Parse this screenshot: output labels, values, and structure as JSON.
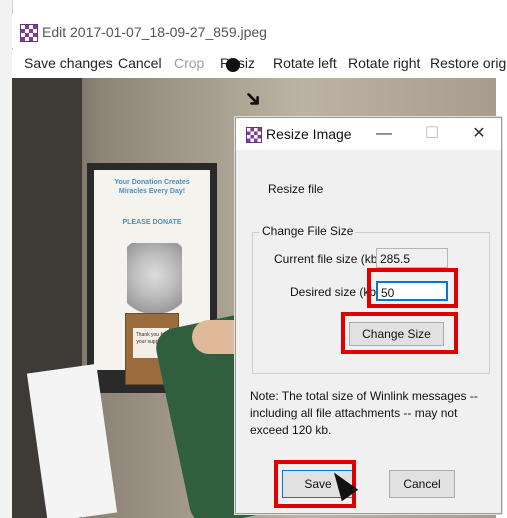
{
  "window": {
    "title": "Edit 2017-01-07_18-09-27_859.jpeg",
    "icon": "app-checker-icon"
  },
  "menu": {
    "items": [
      {
        "label": "Save changes",
        "enabled": true
      },
      {
        "label": "Cancel",
        "enabled": true
      },
      {
        "label": "Crop",
        "enabled": false
      },
      {
        "label": "Resize",
        "enabled": true
      },
      {
        "label": "Rotate left",
        "enabled": true
      },
      {
        "label": "Rotate right",
        "enabled": true
      },
      {
        "label": "Restore original",
        "enabled": true
      }
    ]
  },
  "photo": {
    "poster_title": "Your Donation Creates Miracles Every Day!",
    "poster_cta": "PLEASE DONATE",
    "box_sign": "Thank you for your support!"
  },
  "dialog": {
    "title": "Resize Image",
    "controls": {
      "minimize": "—",
      "maximize": "☐",
      "close": "✕"
    },
    "resize_label": "Resize file",
    "group_label": "Change File Size",
    "current_size_label": "Current file size (kb):",
    "current_size_value": "285.5",
    "desired_size_label": "Desired size (kb):",
    "desired_size_value": "50",
    "change_size_button": "Change Size",
    "note": "Note: The total size of Winlink messages -- including all file attachments -- may not exceed 120 kb.",
    "save_button": "Save",
    "cancel_button": "Cancel"
  },
  "colors": {
    "highlight": "#e00000",
    "focus": "#0078d7",
    "icon_purple": "#7d3c98"
  }
}
